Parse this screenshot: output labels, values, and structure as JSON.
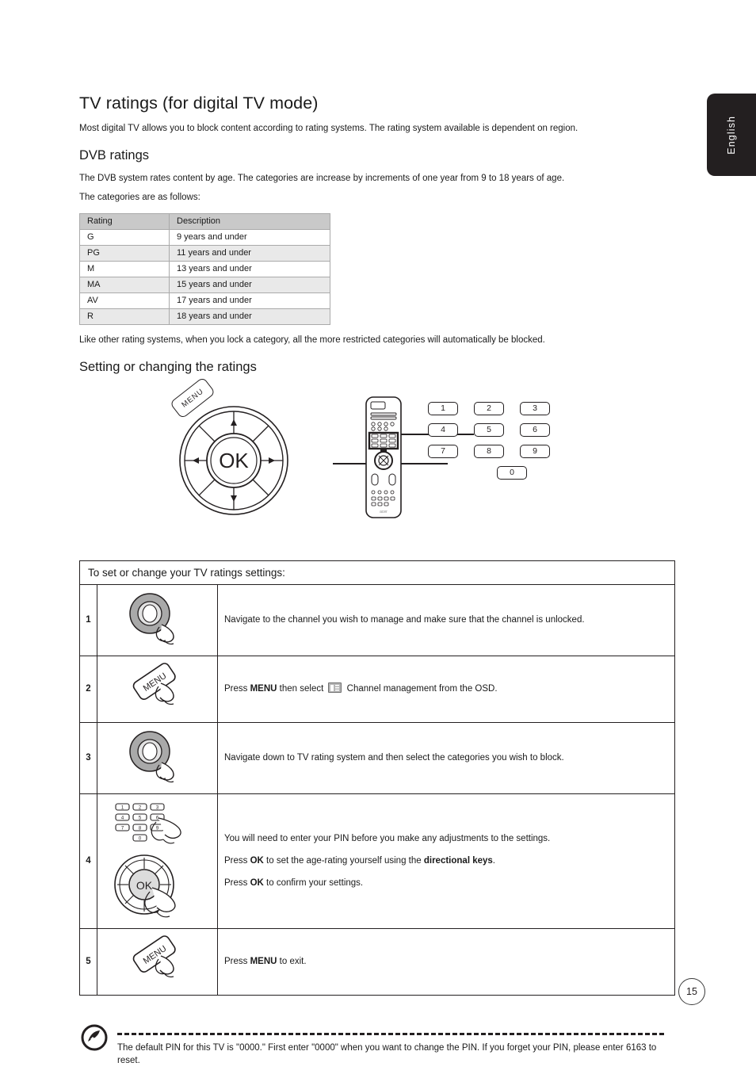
{
  "language_tab": "English",
  "page_number": "15",
  "heading": "TV ratings (for digital TV mode)",
  "intro": "Most digital TV allows you to block content according to rating systems. The rating system available is dependent on region.",
  "dvb": {
    "heading": "DVB ratings",
    "paragraph": "The DVB system rates content by age. The categories are increase by increments of one year from 9 to 18 years of age.",
    "follows": "The categories are as follows:",
    "table": {
      "headers": [
        "Rating",
        "Description"
      ],
      "rows": [
        [
          "G",
          "9 years and under"
        ],
        [
          "PG",
          "11 years and under"
        ],
        [
          "M",
          "13 years and under"
        ],
        [
          "MA",
          "15 years and under"
        ],
        [
          "AV",
          "17 years and under"
        ],
        [
          "R",
          "18 years and under"
        ]
      ]
    },
    "after_table": "Like other rating systems, when you lock a category, all the more restricted categories will automatically be blocked."
  },
  "setting_heading": "Setting or changing the ratings",
  "diagram": {
    "ok_label": "OK",
    "menu_label": "MENU",
    "keypad": [
      [
        "1",
        "2",
        "3"
      ],
      [
        "4",
        "5",
        "6"
      ],
      [
        "7",
        "8",
        "9"
      ],
      [
        "0"
      ]
    ]
  },
  "steps": {
    "caption": "To set or change your TV ratings settings:",
    "rows": [
      {
        "num": "1",
        "icon": "dpad-hand-icon",
        "text_html": "Navigate to the channel you wish to manage and make sure that the channel is unlocked."
      },
      {
        "num": "2",
        "icon": "menu-button-hand-icon",
        "text_before": "Press ",
        "text_bold": "MENU",
        "text_mid": " then select ",
        "text_after": " Channel management from the OSD."
      },
      {
        "num": "3",
        "icon": "dpad-hand-icon",
        "text_html": "Navigate down to TV rating system and then select the categories you wish to block."
      },
      {
        "num": "4",
        "icon": "keypad-and-ok-hand-icon",
        "line1": "You will need to enter your PIN before you make any adjustments to the settings.",
        "line2_a": "Press ",
        "line2_b": "OK",
        "line2_c": " to set the age-rating yourself using the ",
        "line2_d": "directional keys",
        "line2_e": ".",
        "line3_a": "Press ",
        "line3_b": "OK",
        "line3_c": " to confirm your settings."
      },
      {
        "num": "5",
        "icon": "menu-button-hand-icon",
        "text_before": "Press ",
        "text_bold": "MENU",
        "text_after": " to exit."
      }
    ]
  },
  "footnote": {
    "line1": "The default PIN for this TV is \"0000.\" First enter \"0000\" when you want to change the PIN. If you forget your PIN,",
    "line2": "please enter 6163 to reset."
  },
  "colors": {
    "ink": "#231f20",
    "table_header": "#c9c9c9",
    "table_alt": "#e9e9e9",
    "tab_bg": "#231f20"
  }
}
